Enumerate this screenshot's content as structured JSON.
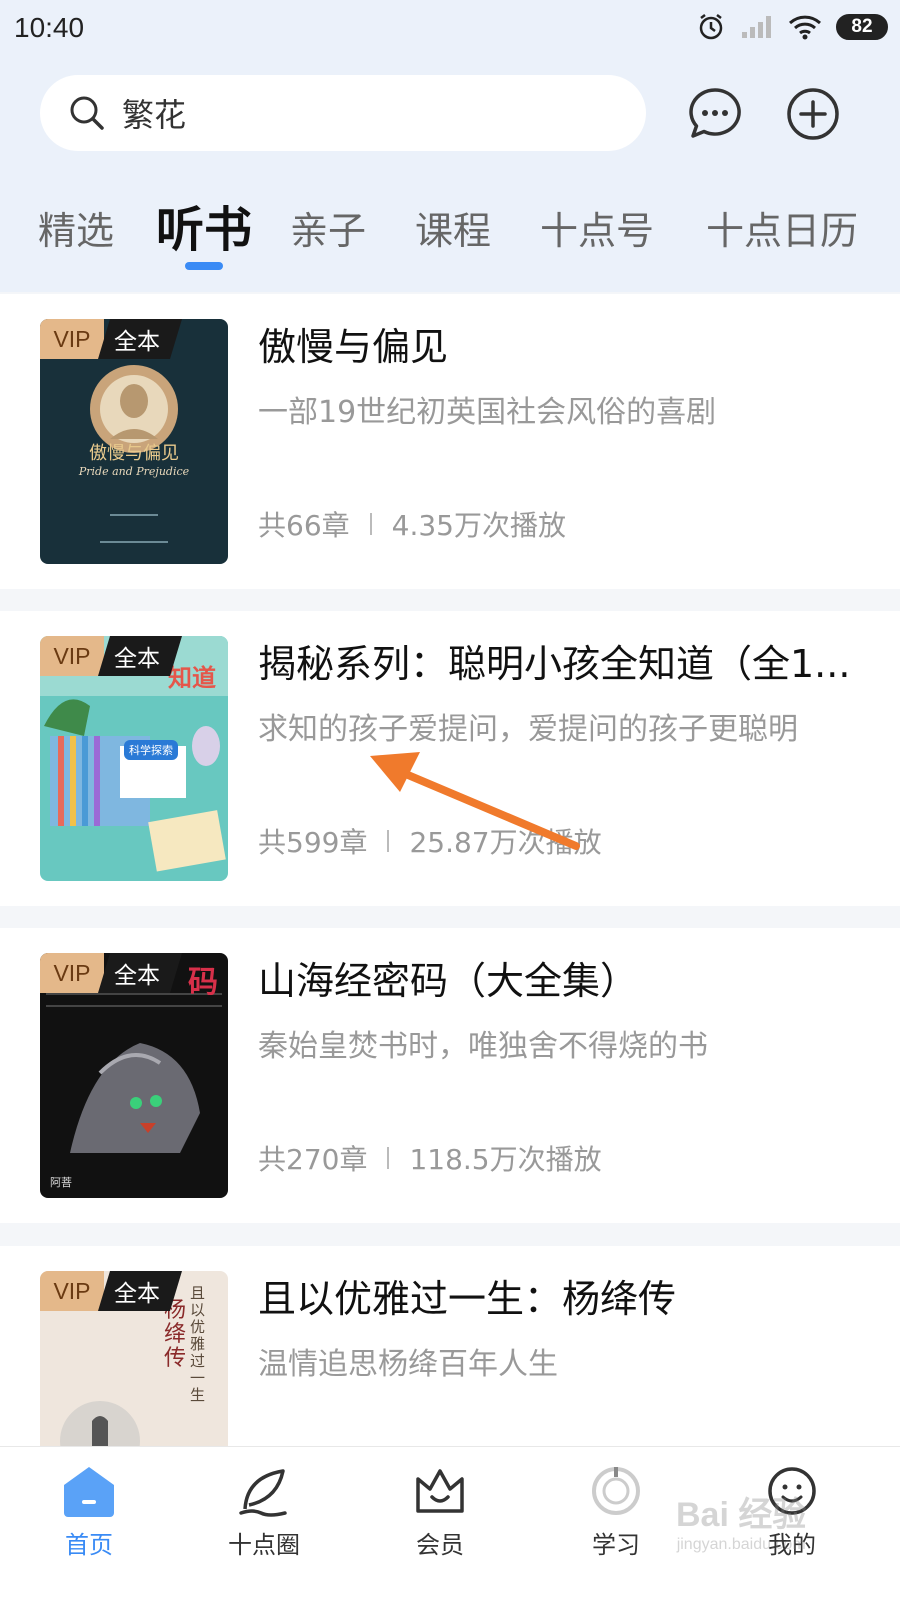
{
  "status_bar": {
    "time": "10:40",
    "battery": "82"
  },
  "search": {
    "text": "繁花"
  },
  "tabs": [
    {
      "label": "精选"
    },
    {
      "label": "听书"
    },
    {
      "label": "亲子"
    },
    {
      "label": "课程"
    },
    {
      "label": "十点号"
    },
    {
      "label": "十点日历"
    }
  ],
  "active_tab_index": 1,
  "books": [
    {
      "badge_vip": "VIP",
      "badge_full": "全本",
      "title": "傲慢与偏见",
      "desc": "一部19世纪初英国社会风俗的喜剧",
      "chapters": "共66章",
      "plays": "4.35万次播放",
      "cover_title": "傲慢与偏见",
      "cover_subtitle": "Pride and Prejudice",
      "cover_color": "#18303a"
    },
    {
      "badge_vip": "VIP",
      "badge_full": "全本",
      "title": "揭秘系列：聪明小孩全知道（全1...",
      "desc": "求知的孩子爱提问，爱提问的孩子更聪明",
      "chapters": "共599章",
      "plays": "25.87万次播放",
      "cover_title": "知道",
      "cover_subtitle": "科学探索",
      "cover_color": "#68c8c0"
    },
    {
      "badge_vip": "VIP",
      "badge_full": "全本",
      "title": "山海经密码（大全集）",
      "desc": "秦始皇焚书时，唯独舍不得烧的书",
      "chapters": "共270章",
      "plays": "118.5万次播放",
      "cover_title": "码",
      "cover_subtitle": "阿菩",
      "cover_color": "#111111"
    },
    {
      "badge_vip": "VIP",
      "badge_full": "全本",
      "title": "且以优雅过一生：杨绛传",
      "desc": "温情追思杨绛百年人生",
      "chapters": "",
      "plays": "",
      "cover_title": "且以优雅过一生",
      "cover_subtitle": "杨绛传",
      "cover_color": "#efe6dd"
    }
  ],
  "bottom_nav": [
    {
      "label": "首页",
      "icon": "home-icon"
    },
    {
      "label": "十点圈",
      "icon": "leaf-icon"
    },
    {
      "label": "会员",
      "icon": "crown-icon"
    },
    {
      "label": "学习",
      "icon": "study-icon"
    },
    {
      "label": "我的",
      "icon": "profile-icon"
    }
  ],
  "colors": {
    "accent": "#3a8bf5",
    "header_bg": "#ebf1fa",
    "annotation_arrow": "#f07a2c"
  },
  "watermark": {
    "text": "Bai 经验",
    "subtext": "jingyan.baidu.com"
  }
}
